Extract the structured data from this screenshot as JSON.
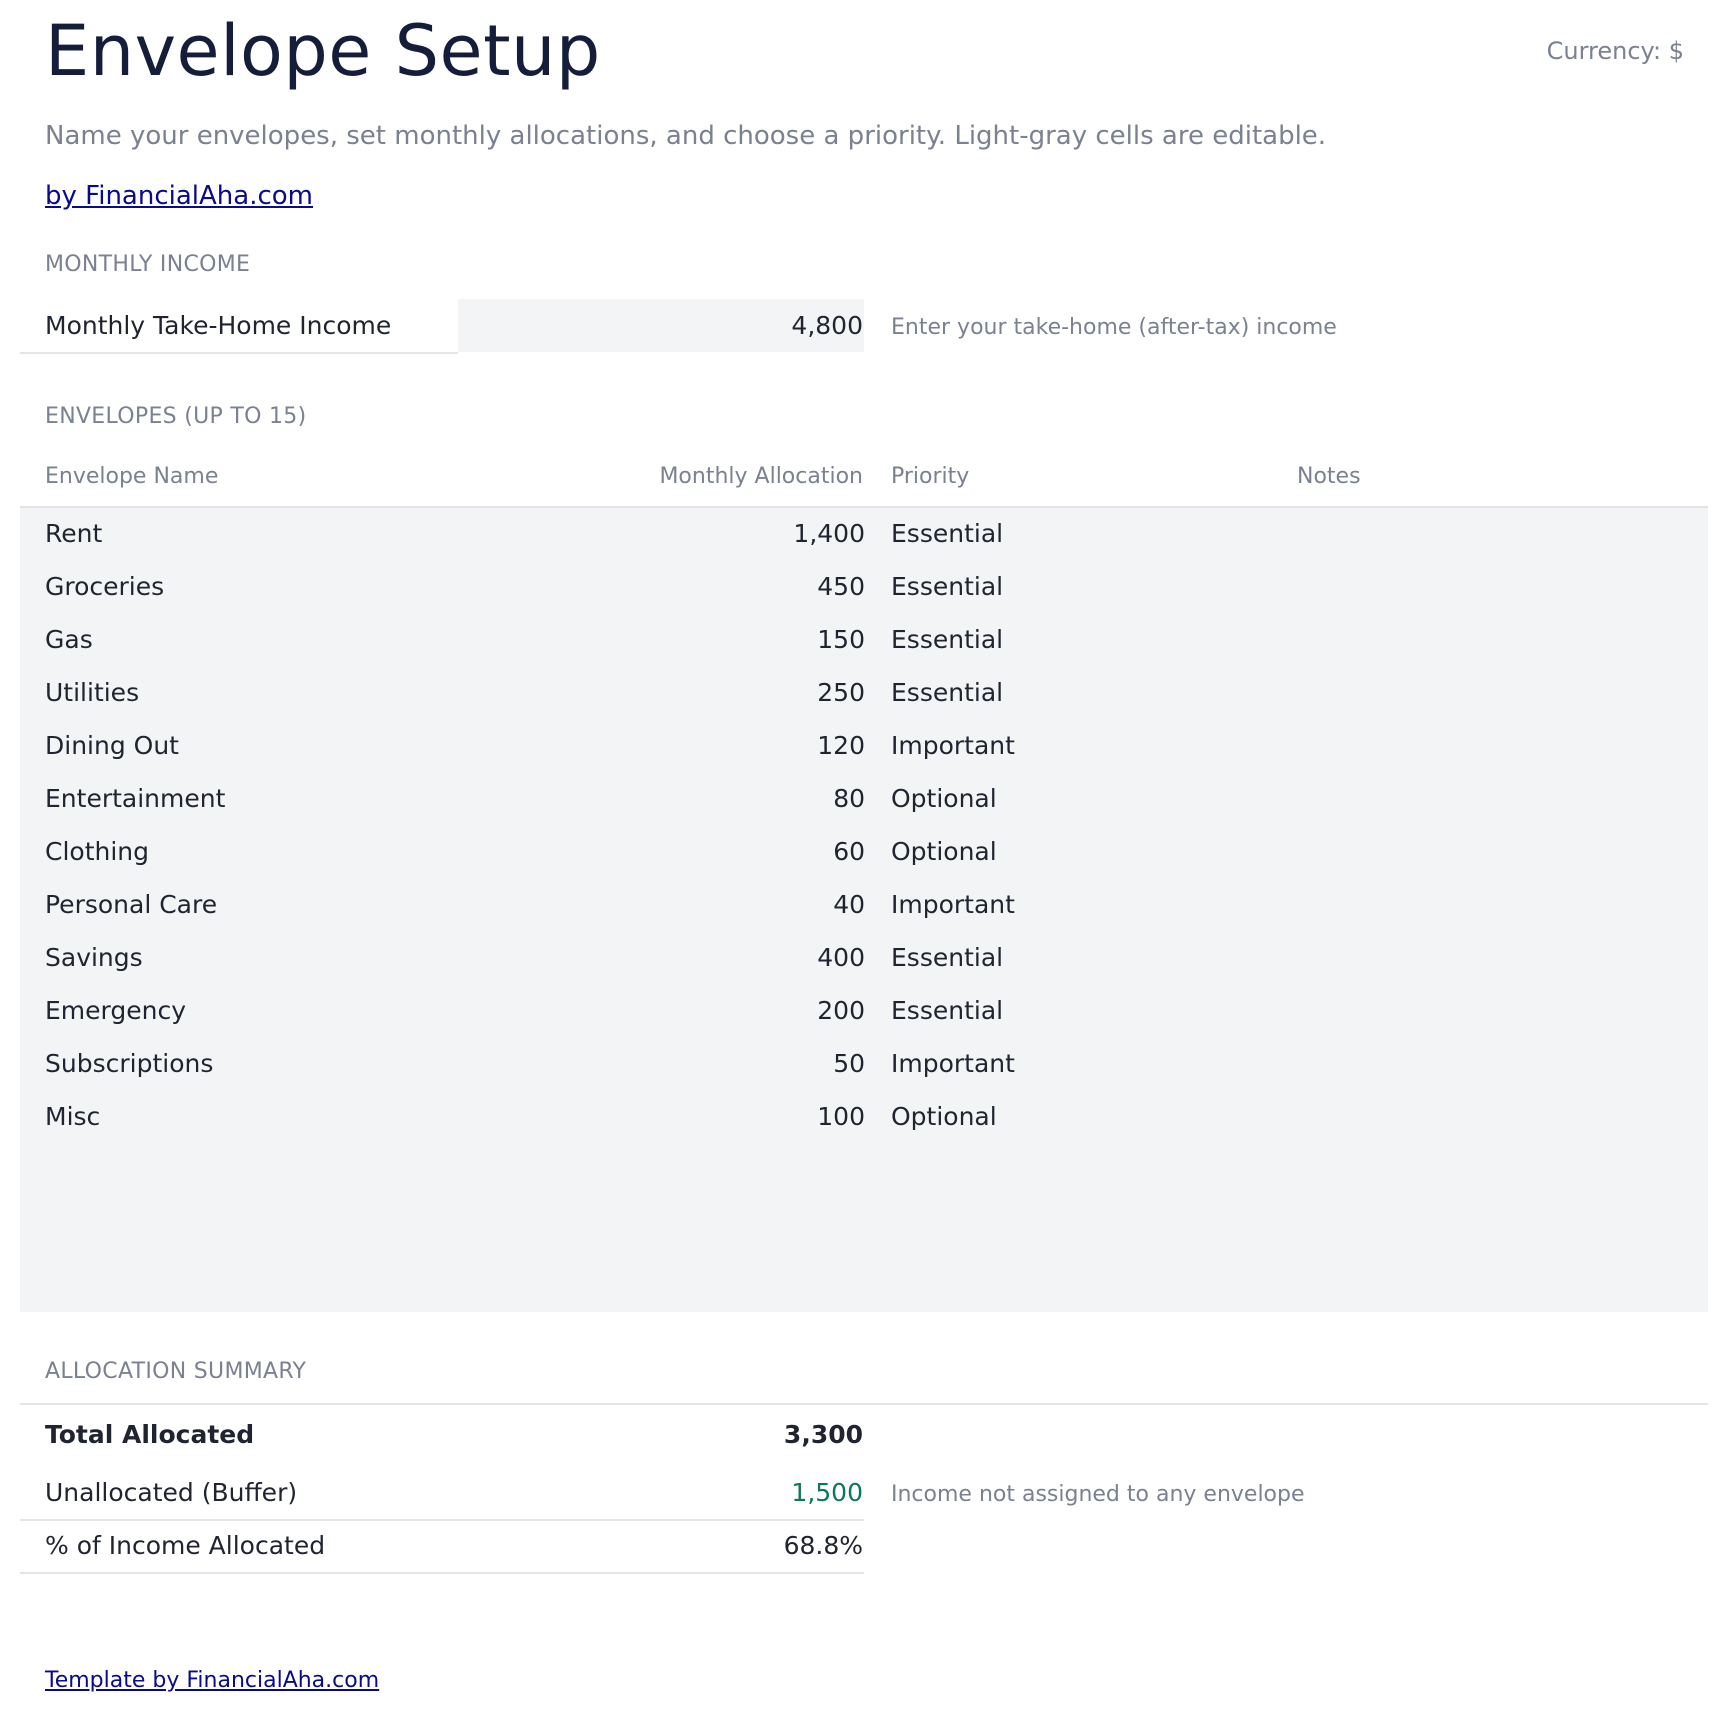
{
  "header": {
    "title": "Envelope Setup",
    "currency": "Currency: $",
    "subtitle": "Name your envelopes, set monthly allocations, and choose a priority. Light-gray cells are editable.",
    "byline": "by FinancialAha.com"
  },
  "income": {
    "section_label": "MONTHLY INCOME",
    "label": "Monthly Take-Home Income",
    "value": "4,800",
    "hint": "Enter your take-home (after-tax) income"
  },
  "envelopes": {
    "section_label": "ENVELOPES (UP TO 15)",
    "columns": {
      "name": "Envelope Name",
      "allocation": "Monthly Allocation",
      "priority": "Priority",
      "notes": "Notes"
    },
    "rows": [
      {
        "name": "Rent",
        "amount": "1,400",
        "priority": "Essential"
      },
      {
        "name": "Groceries",
        "amount": "450",
        "priority": "Essential"
      },
      {
        "name": "Gas",
        "amount": "150",
        "priority": "Essential"
      },
      {
        "name": "Utilities",
        "amount": "250",
        "priority": "Essential"
      },
      {
        "name": "Dining Out",
        "amount": "120",
        "priority": "Important"
      },
      {
        "name": "Entertainment",
        "amount": "80",
        "priority": "Optional"
      },
      {
        "name": "Clothing",
        "amount": "60",
        "priority": "Optional"
      },
      {
        "name": "Personal Care",
        "amount": "40",
        "priority": "Important"
      },
      {
        "name": "Savings",
        "amount": "400",
        "priority": "Essential"
      },
      {
        "name": "Emergency",
        "amount": "200",
        "priority": "Essential"
      },
      {
        "name": "Subscriptions",
        "amount": "50",
        "priority": "Important"
      },
      {
        "name": "Misc",
        "amount": "100",
        "priority": "Optional"
      }
    ]
  },
  "summary": {
    "section_label": "ALLOCATION SUMMARY",
    "total_label": "Total Allocated",
    "total_value": "3,300",
    "unallocated_label": "Unallocated (Buffer)",
    "unallocated_value": "1,500",
    "unallocated_hint": "Income not assigned to any envelope",
    "percent_label": "% of Income Allocated",
    "percent_value": "68.8%"
  },
  "footer": {
    "link": "Template by FinancialAha.com"
  },
  "colors": {
    "title": "#141e3a",
    "muted": "#7a8191",
    "link": "#0a0a8c",
    "editable_bg": "#f3f4f6",
    "positive": "#0b7a52"
  }
}
